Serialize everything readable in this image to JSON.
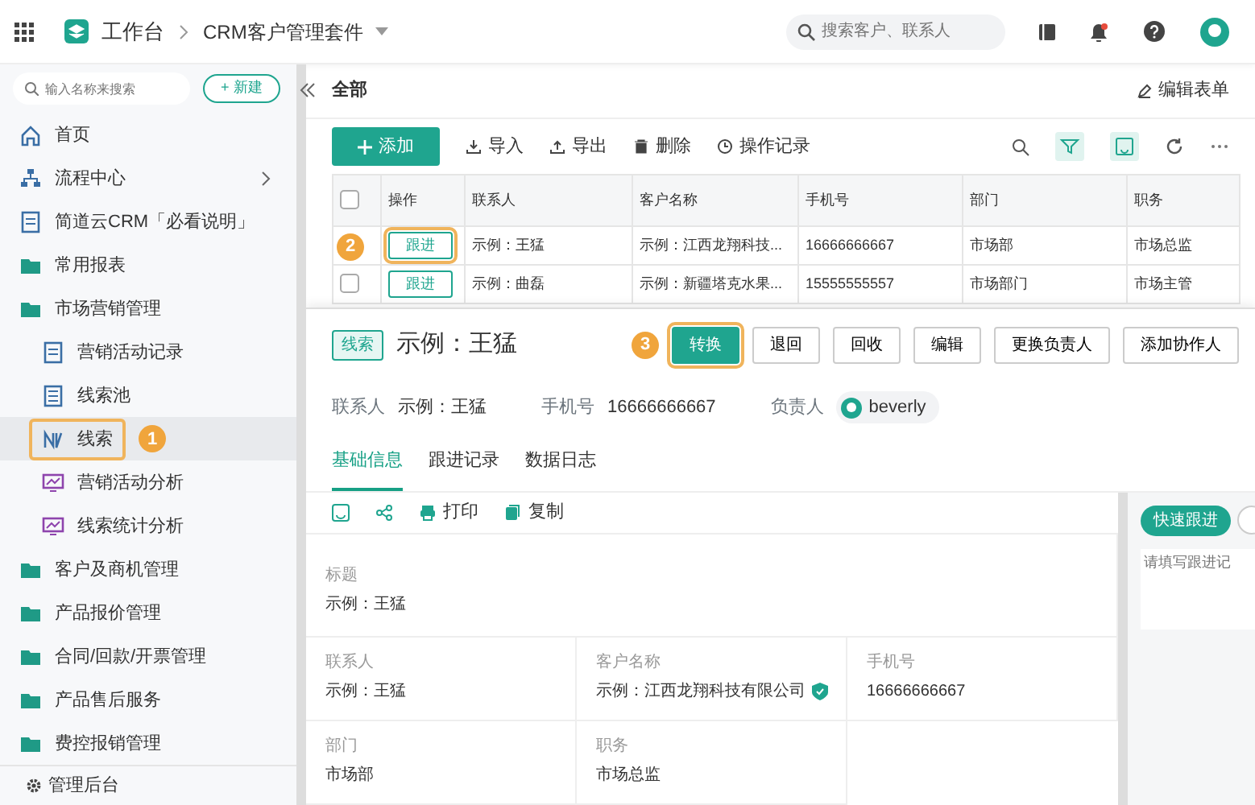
{
  "topbar": {
    "home": "工作台",
    "app": "CRM客户管理套件",
    "search": {
      "placeholder": "搜索客户、联系人"
    },
    "has_notification": true
  },
  "sidebar": {
    "search": {
      "placeholder": "输入名称来搜索"
    },
    "new_button": "+ 新建",
    "items": [
      {
        "label": "首页",
        "kind": "home",
        "selected": false
      },
      {
        "label": "流程中心",
        "kind": "flow",
        "selected": false
      },
      {
        "label": "简道云CRM「必看说明」",
        "kind": "doc",
        "selected": false
      },
      {
        "label": "常用报表",
        "kind": "folder",
        "selected": false
      },
      {
        "label": "市场营销管理",
        "kind": "folder",
        "selected": false,
        "children": [
          {
            "label": "营销活动记录",
            "kind": "doc",
            "selected": false
          },
          {
            "label": "线索池",
            "kind": "pool",
            "selected": false
          },
          {
            "label": "线索",
            "kind": "lead",
            "selected": true,
            "callout": "1"
          },
          {
            "label": "营销活动分析",
            "kind": "chart",
            "selected": false
          },
          {
            "label": "线索统计分析",
            "kind": "chart",
            "selected": false
          }
        ]
      },
      {
        "label": "客户及商机管理",
        "kind": "folder",
        "selected": false
      },
      {
        "label": "产品报价管理",
        "kind": "folder",
        "selected": false
      },
      {
        "label": "合同/回款/开票管理",
        "kind": "folder",
        "selected": false
      },
      {
        "label": "产品售后服务",
        "kind": "folder",
        "selected": false
      },
      {
        "label": "费控报销管理",
        "kind": "folder",
        "selected": false
      }
    ],
    "footer": "管理后台"
  },
  "list": {
    "title": "全部",
    "edit_form": "编辑表单",
    "add_button": "添加",
    "tools": [
      {
        "label": "导入",
        "kind": "import"
      },
      {
        "label": "导出",
        "kind": "export"
      },
      {
        "label": "删除",
        "kind": "delete"
      },
      {
        "label": "操作记录",
        "kind": "history"
      }
    ],
    "table": {
      "header_checked": false,
      "columns": [
        "操作",
        "联系人",
        "客户名称",
        "手机号",
        "部门",
        "职务"
      ],
      "rows": [
        {
          "callout": "2",
          "cells": [
            "跟进",
            "示例：王猛",
            "示例：江西龙翔科技...",
            "16666666667",
            "市场部",
            "市场总监"
          ]
        },
        {
          "checked": false,
          "cells": [
            "跟进",
            "示例：曲磊",
            "示例：新疆塔克水果...",
            "15555555557",
            "市场部门",
            "市场主管"
          ]
        }
      ]
    }
  },
  "detail": {
    "tag": "线索",
    "title": "示例：王猛",
    "buttons": [
      {
        "label": "转换",
        "primary": true,
        "callout": "3"
      },
      {
        "label": "退回",
        "primary": false
      },
      {
        "label": "回收",
        "primary": false
      },
      {
        "label": "编辑",
        "primary": false
      },
      {
        "label": "更换负责人",
        "primary": false
      },
      {
        "label": "添加协作人",
        "primary": false
      }
    ],
    "meta": [
      {
        "label": "联系人",
        "value": "示例：王猛"
      },
      {
        "label": "手机号",
        "value": "16666666667"
      }
    ],
    "owner_label": "负责人",
    "owner": "beverly",
    "tabs": [
      {
        "label": "基础信息",
        "selected": true
      },
      {
        "label": "跟进记录",
        "selected": false
      },
      {
        "label": "数据日志",
        "selected": false
      }
    ],
    "actions": [
      "打印",
      "复制"
    ],
    "fields": [
      [
        {
          "label": "标题",
          "value": "示例：王猛"
        }
      ],
      [
        {
          "label": "联系人",
          "value": "示例：王猛"
        },
        {
          "label": "客户名称",
          "value": "示例：江西龙翔科技有限公司",
          "verified": true
        },
        {
          "label": "手机号",
          "value": "16666666667"
        }
      ],
      [
        {
          "label": "部门",
          "value": "市场部"
        },
        {
          "label": "职务",
          "value": "市场总监"
        }
      ]
    ],
    "quick_follow": "快速跟进",
    "follow_placeholder": "请填写跟进记"
  }
}
